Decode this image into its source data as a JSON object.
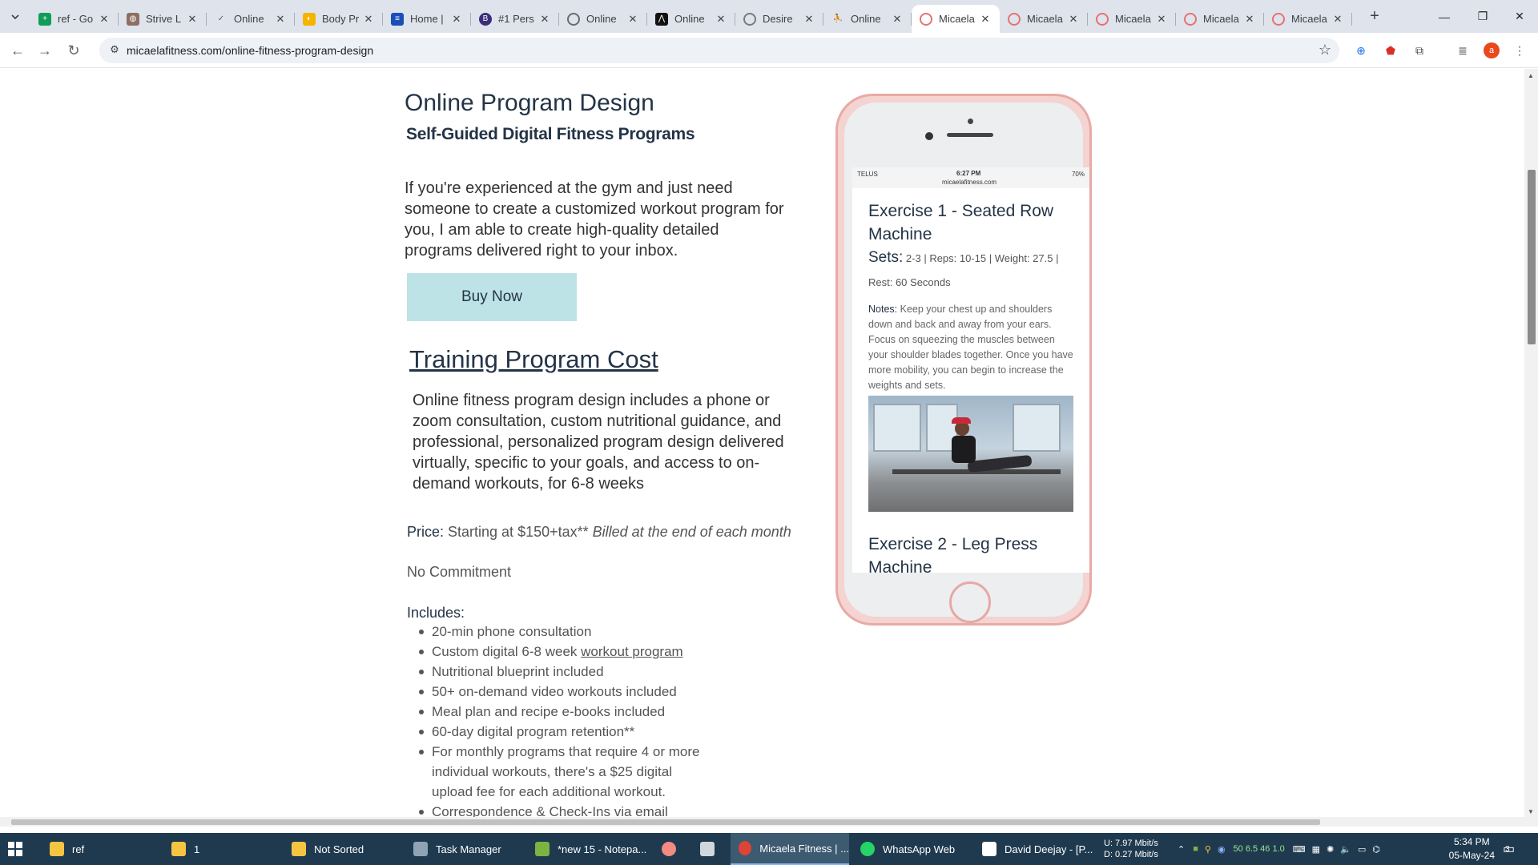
{
  "browser": {
    "tabs": [
      {
        "title": "ref - Go",
        "favicon": "sheets-icon",
        "color": "#0f9d58"
      },
      {
        "title": "Strive L",
        "favicon": "strive-icon",
        "color": "#8d6e63"
      },
      {
        "title": "Online",
        "favicon": "check-icon",
        "color": "#5f6368"
      },
      {
        "title": "Body Pr",
        "favicon": "bodypro-icon",
        "color": "#f4b400"
      },
      {
        "title": "Home |",
        "favicon": "menu-icon",
        "color": "#1a4fb8"
      },
      {
        "title": "#1 Pers",
        "favicon": "pers-icon",
        "color": "#3b2e7a"
      },
      {
        "title": "Online",
        "favicon": "globe-icon",
        "color": "#6b6b6b"
      },
      {
        "title": "Online",
        "favicon": "mountain-icon",
        "color": "#111111"
      },
      {
        "title": "Desire",
        "favicon": "desire-icon",
        "color": "#7a7a7a"
      },
      {
        "title": "Online",
        "favicon": "runner-icon",
        "color": "#7a7a7a"
      },
      {
        "title": "Micaela",
        "favicon": "micaela-icon",
        "color": "#e57373",
        "active": true
      },
      {
        "title": "Micaela",
        "favicon": "micaela-icon",
        "color": "#e57373"
      },
      {
        "title": "Micaela",
        "favicon": "micaela-icon",
        "color": "#e57373"
      },
      {
        "title": "Micaela",
        "favicon": "micaela-icon",
        "color": "#e57373"
      },
      {
        "title": "Micaela",
        "favicon": "micaela-icon",
        "color": "#e57373"
      }
    ],
    "url": "micaelafitness.com/online-fitness-program-design",
    "profile_initial": "a"
  },
  "page": {
    "heading": "Online Program Design",
    "subheading": "Self-Guided Digital Fitness Programs",
    "intro": "If you're experienced at the gym and just need someone to create a customized workout program for you, I am able to create high-quality detailed programs delivered right to your inbox.",
    "buy_label": "Buy Now",
    "cost_title": "Training Program Cost",
    "cost_body": "Online fitness program design includes a phone or zoom consultation,  custom nutritional guidance, and professional, personalized program design delivered virtually, specific to your goals, and access to on-demand workouts, for 6-8 weeks",
    "price_label": "Price:",
    "price_value": " Starting at $150+tax** ",
    "price_note": "Billed at the end of each month",
    "no_commitment": "No Commitment",
    "includes_label": "Includes:",
    "includes": {
      "i1": "20-min phone consultation",
      "i2_prefix": "Custom digital 6-8 week ",
      "i2_link": "workout program",
      "i3": "Nutritional blueprint included",
      "i4": "50+ on-demand video workouts included",
      "i5": "Meal plan and recipe e-books included",
      "i6": "60-day digital program retention**",
      "i7": "For monthly programs that require 4 or more individual workouts, there's a $25 digital upload fee for each additional workout.",
      "i8": "Correspondence & Check-Ins via email"
    }
  },
  "phone": {
    "carrier": "TELUS",
    "time": "6:27 PM",
    "battery": "70%",
    "site": "micaelafitness.com",
    "exercise1": "Exercise 1 - Seated Row Machine",
    "sets_label": "Sets:",
    "sets_detail": " 2-3 | Reps: 10-15 | Weight: 27.5 | Rest: 60 Seconds",
    "notes_label": "Notes:",
    "notes_text": " Keep your chest up and shoulders down and back and away from your ears. Focus on squeezing the muscles between your shoulder blades together. Once you have more mobility, you can begin to increase the weights and sets.",
    "exercise2": "Exercise 2 - Leg Press Machine"
  },
  "taskbar": {
    "items": [
      {
        "label": "ref"
      },
      {
        "label": "1"
      },
      {
        "label": "Not Sorted"
      },
      {
        "label": "Task Manager"
      },
      {
        "label": "*new 15 - Notepa..."
      },
      {
        "label": ""
      },
      {
        "label": ""
      },
      {
        "label": "Micaela Fitness | ..."
      },
      {
        "label": "WhatsApp Web"
      },
      {
        "label": "David Deejay - [P..."
      }
    ],
    "net_up": "U:   7.97 Mbit/s",
    "net_down": "D:   0.27 Mbit/s",
    "tray_nums": "50  6.5  46  1.0",
    "time": "5:34 PM",
    "date": "05-May-24",
    "notif_count": "3"
  }
}
